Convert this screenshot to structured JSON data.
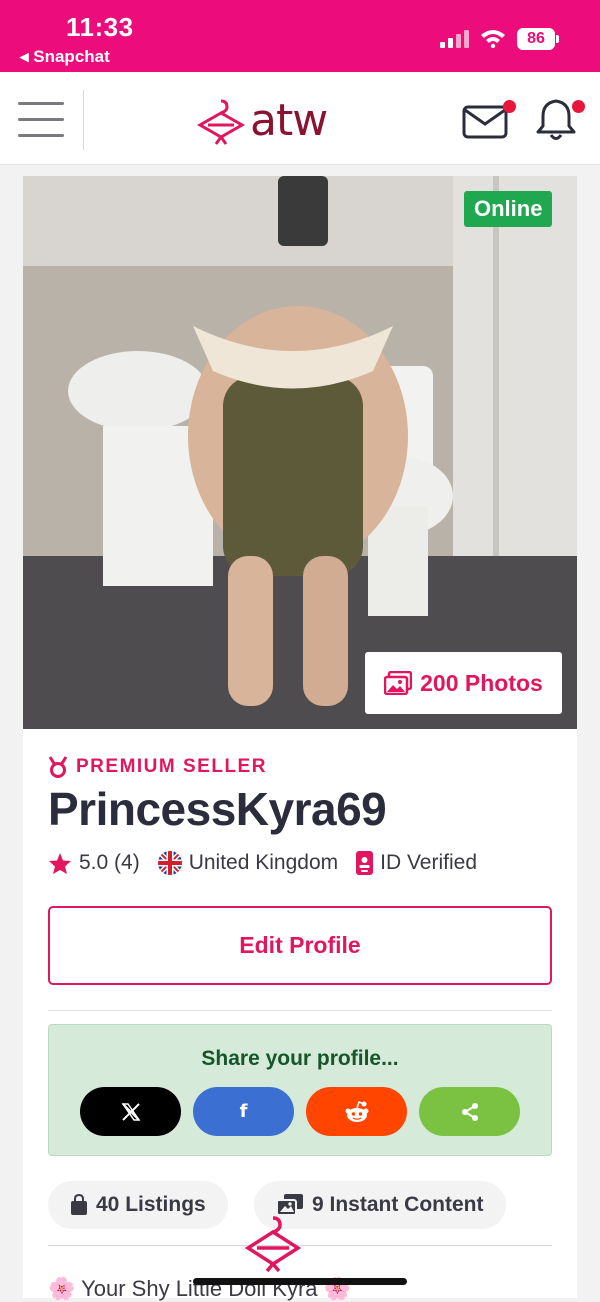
{
  "status_bar": {
    "time": "11:33",
    "back_app": "◂ Snapchat",
    "battery": "86",
    "icons": [
      "signal-icon",
      "wifi-icon",
      "battery-icon"
    ]
  },
  "header": {
    "logo_text": "atw",
    "icons": [
      "hamburger-menu-icon",
      "mail-icon",
      "bell-icon"
    ],
    "notification_dot_color": "#e8163a"
  },
  "profile": {
    "status_badge": "Online",
    "photos_label": "200 Photos",
    "premium_label": "PREMIUM SELLER",
    "username": "PrincessKyra69",
    "rating": "5.0 (4)",
    "country": "United Kingdom",
    "verified": "ID Verified",
    "edit_button": "Edit Profile"
  },
  "share": {
    "title": "Share your profile...",
    "buttons": [
      {
        "name": "x",
        "glyph": "𝕏",
        "color": "#000000"
      },
      {
        "name": "facebook",
        "glyph": "f",
        "color": "#3b6fd1"
      },
      {
        "name": "reddit",
        "glyph": "reddit",
        "color": "#ff4500"
      },
      {
        "name": "share",
        "glyph": "share",
        "color": "#7cc242"
      }
    ]
  },
  "stats": {
    "listings": "40 Listings",
    "instant_content": "9 Instant Content"
  },
  "bio_first_line": "🌸 Your Shy Little Doll Kyra 🌸",
  "colors": {
    "brand_pink": "#ec0c7c",
    "accent": "#e2165e",
    "online_green": "#1fa850",
    "share_bg": "#d5ead9"
  }
}
